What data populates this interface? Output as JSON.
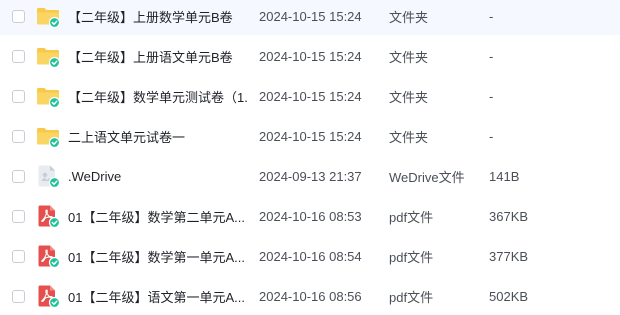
{
  "files": [
    {
      "name": "【二年级】上册数学单元B卷",
      "date": "2024-10-15 15:24",
      "type": "文件夹",
      "size": "-",
      "icon": "shared-folder-icon"
    },
    {
      "name": "【二年级】上册语文单元B卷",
      "date": "2024-10-15 15:24",
      "type": "文件夹",
      "size": "-",
      "icon": "shared-folder-icon"
    },
    {
      "name": "【二年级】数学单元测试卷（1...",
      "date": "2024-10-15 15:24",
      "type": "文件夹",
      "size": "-",
      "icon": "shared-folder-icon"
    },
    {
      "name": "二上语文单元试卷一",
      "date": "2024-10-15 15:24",
      "type": "文件夹",
      "size": "-",
      "icon": "shared-folder-icon"
    },
    {
      "name": ".WeDrive",
      "date": "2024-09-13 21:37",
      "type": "WeDrive文件",
      "size": "141B",
      "icon": "synced-file-icon"
    },
    {
      "name": "01【二年级】数学第二单元A...",
      "date": "2024-10-16 08:53",
      "type": "pdf文件",
      "size": "367KB",
      "icon": "pdf-file-icon"
    },
    {
      "name": "01【二年级】数学第一单元A...",
      "date": "2024-10-16 08:54",
      "type": "pdf文件",
      "size": "377KB",
      "icon": "pdf-file-icon"
    },
    {
      "name": "01【二年级】语文第一单元A...",
      "date": "2024-10-16 08:56",
      "type": "pdf文件",
      "size": "502KB",
      "icon": "pdf-file-icon"
    }
  ],
  "colors": {
    "folder": "#f8c94a",
    "sync_badge": "#1fc29b",
    "pdf": "#e5504f"
  }
}
